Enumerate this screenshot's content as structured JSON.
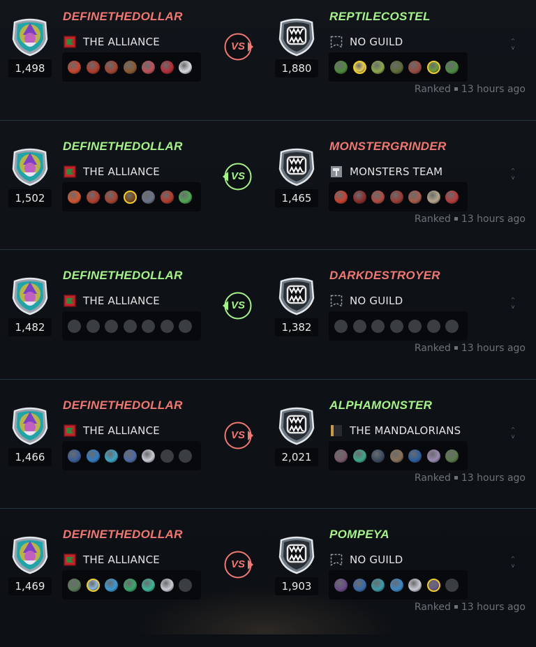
{
  "colors": {
    "win": "#a6f28a",
    "lose": "#f07872",
    "card_empty": "#3a3d41",
    "panel": "#07090c"
  },
  "battles": [
    {
      "vs_label": "VS",
      "vs_result": "lose",
      "left": {
        "name": "DEFINETHEDOLLAR",
        "result": "lose",
        "rating": "1,498",
        "guild": "THE ALLIANCE",
        "guild_icon": "alliance-banner-icon",
        "avatar_icon": "wizard-avatar-icon",
        "cards": [
          "#c9442c",
          "#b23a2a",
          "#a34432",
          "#8a5a30",
          "#c0505a",
          "#b52c36",
          "#d9dbe0"
        ]
      },
      "right": {
        "name": "REPTILECOSTEL",
        "result": "win",
        "rating": "1,880",
        "guild": "NO GUILD",
        "guild_icon": "empty-guild-icon",
        "avatar_icon": "monster-avatar-icon",
        "cards": [
          "#4f8a3a",
          "#e2cc54",
          "#8aa84a",
          "#5b6b36",
          "#9a4a3e",
          "#6c9e3a",
          "#4c8a42"
        ],
        "gold": [
          1,
          5
        ]
      },
      "ranked": "Ranked",
      "time": "13 hours ago",
      "toggle_up": "^",
      "toggle_down": "v"
    },
    {
      "vs_label": "VS",
      "vs_result": "win",
      "left": {
        "name": "DEFINETHEDOLLAR",
        "result": "win",
        "rating": "1,502",
        "guild": "THE ALLIANCE",
        "guild_icon": "alliance-banner-icon",
        "avatar_icon": "wizard-avatar-icon",
        "cards": [
          "#d4542c",
          "#b33c2c",
          "#a44230",
          "#7a4a1e",
          "#6a7488",
          "#b23a2c",
          "#4ea854"
        ],
        "gold": [
          3
        ]
      },
      "right": {
        "name": "MONSTERGRINDER",
        "result": "lose",
        "rating": "1,465",
        "guild": "MONSTERS TEAM",
        "guild_icon": "hammer-banner-icon",
        "avatar_icon": "monster-avatar-icon",
        "cards": [
          "#c8402c",
          "#8a2c2c",
          "#b04a40",
          "#9a3a34",
          "#a85a4a",
          "#b6a68a",
          "#b83a3a"
        ]
      },
      "ranked": "Ranked",
      "time": "13 hours ago",
      "toggle_up": "^",
      "toggle_down": "v"
    },
    {
      "vs_label": "VS",
      "vs_result": "win",
      "left": {
        "name": "DEFINETHEDOLLAR",
        "result": "win",
        "rating": "1,482",
        "guild": "THE ALLIANCE",
        "guild_icon": "alliance-banner-icon",
        "avatar_icon": "wizard-avatar-icon",
        "cards": [
          "",
          "",
          "",
          "",
          "",
          "",
          ""
        ]
      },
      "right": {
        "name": "DARKDESTROYER",
        "result": "lose",
        "rating": "1,382",
        "guild": "NO GUILD",
        "guild_icon": "empty-guild-icon",
        "avatar_icon": "monster-avatar-icon",
        "cards": [
          "",
          "",
          "",
          "",
          "",
          "",
          ""
        ]
      },
      "ranked": "Ranked",
      "time": "13 hours ago",
      "toggle_up": "^",
      "toggle_down": "v"
    },
    {
      "vs_label": "VS",
      "vs_result": "lose",
      "left": {
        "name": "DEFINETHEDOLLAR",
        "result": "lose",
        "rating": "1,466",
        "guild": "THE ALLIANCE",
        "guild_icon": "alliance-banner-icon",
        "avatar_icon": "wizard-avatar-icon",
        "cards": [
          "#3a5e9a",
          "#2f7cc4",
          "#3ea4c6",
          "#4c6aa8",
          "#c8ccd4",
          "",
          ""
        ]
      },
      "right": {
        "name": "ALPHAMONSTER",
        "result": "win",
        "rating": "2,021",
        "guild": "THE MANDALORIANS",
        "guild_icon": "mandalorian-banner-icon",
        "avatar_icon": "monster-avatar-icon",
        "cards": [
          "#7a5a6a",
          "#3ea88a",
          "#3a4a5e",
          "#8a7058",
          "#2c5ea0",
          "#9a88b0",
          "#5a7a4a"
        ]
      },
      "ranked": "Ranked",
      "time": "13 hours ago",
      "toggle_up": "^",
      "toggle_down": "v"
    },
    {
      "vs_label": "VS",
      "vs_result": "lose",
      "left": {
        "name": "DEFINETHEDOLLAR",
        "result": "lose",
        "rating": "1,469",
        "guild": "THE ALLIANCE",
        "guild_icon": "alliance-banner-icon",
        "avatar_icon": "wizard-avatar-icon",
        "cards": [
          "#5a7a5a",
          "#8ab8d8",
          "#3a9ad8",
          "#3aa86a",
          "#3ab89a",
          "#c8ccd4",
          ""
        ],
        "gold": [
          1
        ]
      },
      "right": {
        "name": "POMPEYA",
        "result": "win",
        "rating": "1,903",
        "guild": "NO GUILD",
        "guild_icon": "empty-guild-icon",
        "avatar_icon": "monster-avatar-icon",
        "cards": [
          "#6a4a8a",
          "#3a6aa8",
          "#3a9aa8",
          "#3a88c8",
          "#c8ccd4",
          "#6a5a8a",
          ""
        ],
        "gold": [
          5
        ]
      },
      "ranked": "Ranked",
      "time": "13 hours ago",
      "toggle_up": "^",
      "toggle_down": "v"
    }
  ]
}
